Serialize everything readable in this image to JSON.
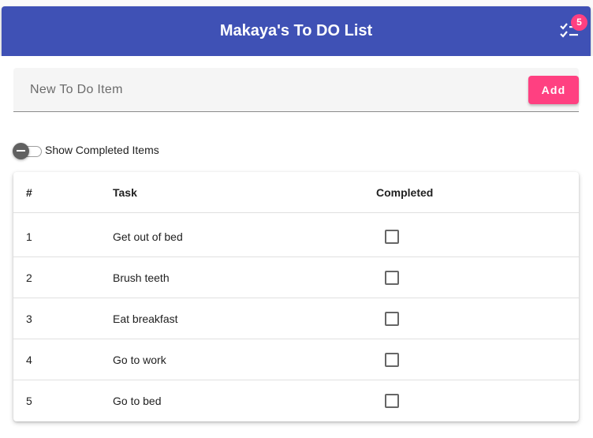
{
  "app": {
    "title": "Makaya's To DO List",
    "badge_count": "5",
    "icon": "checklist-icon",
    "colors": {
      "primary": "#3f51b5",
      "accent": "#ff4081"
    }
  },
  "new_item": {
    "placeholder": "New To Do Item",
    "value": "",
    "add_label": "Add"
  },
  "toggle": {
    "label": "Show Completed Items",
    "checked": false
  },
  "table": {
    "headers": {
      "num": "#",
      "task": "Task",
      "completed": "Completed"
    },
    "rows": [
      {
        "num": "1",
        "task": "Get out of bed",
        "completed": false
      },
      {
        "num": "2",
        "task": "Brush teeth",
        "completed": false
      },
      {
        "num": "3",
        "task": "Eat breakfast",
        "completed": false
      },
      {
        "num": "4",
        "task": "Go to work",
        "completed": false
      },
      {
        "num": "5",
        "task": "Go to bed",
        "completed": false
      }
    ]
  }
}
